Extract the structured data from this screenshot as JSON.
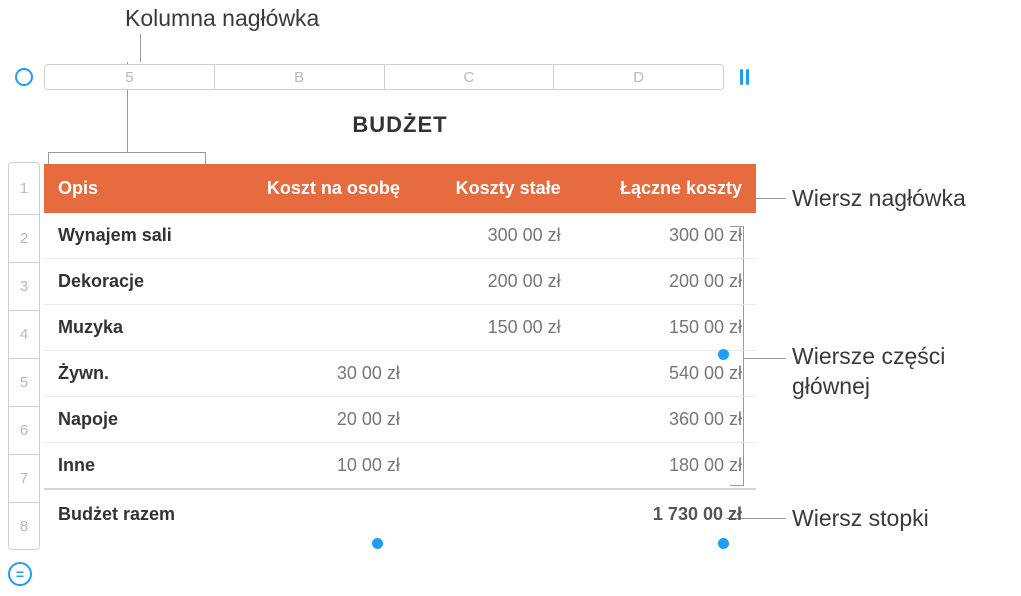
{
  "callouts": {
    "header_col": "Kolumna nagłówka",
    "header_row": "Wiersz nagłówka",
    "body_rows_l1": "Wiersze części",
    "body_rows_l2": "głównej",
    "footer_row": "Wiersz stopki"
  },
  "column_labels": {
    "c1": "5",
    "c2": "B",
    "c3": "C",
    "c4": "D"
  },
  "row_labels": [
    "1",
    "2",
    "3",
    "4",
    "5",
    "6",
    "7",
    "8"
  ],
  "table": {
    "title": "BUDŻET",
    "headers": {
      "desc": "Opis",
      "per": "Koszt na osobę",
      "fixed": "Koszty stałe",
      "total": "Łączne koszty"
    },
    "rows": [
      {
        "desc": "Wynajem sali",
        "per": "",
        "fixed": "300 00 zł",
        "total": "300 00 zł"
      },
      {
        "desc": "Dekoracje",
        "per": "",
        "fixed": "200 00 zł",
        "total": "200 00 zł"
      },
      {
        "desc": "Muzyka",
        "per": "",
        "fixed": "150 00 zł",
        "total": "150 00 zł"
      },
      {
        "desc": "Żywn.",
        "per": "30 00 zł",
        "fixed": "",
        "total": "540 00 zł"
      },
      {
        "desc": "Napoje",
        "per": "20 00 zł",
        "fixed": "",
        "total": "360 00 zł"
      },
      {
        "desc": "Inne",
        "per": "10 00 zł",
        "fixed": "",
        "total": "180 00 zł"
      }
    ],
    "footer": {
      "desc": "Budżet razem",
      "per": "",
      "fixed": "",
      "total": "1 730 00 zł"
    }
  }
}
